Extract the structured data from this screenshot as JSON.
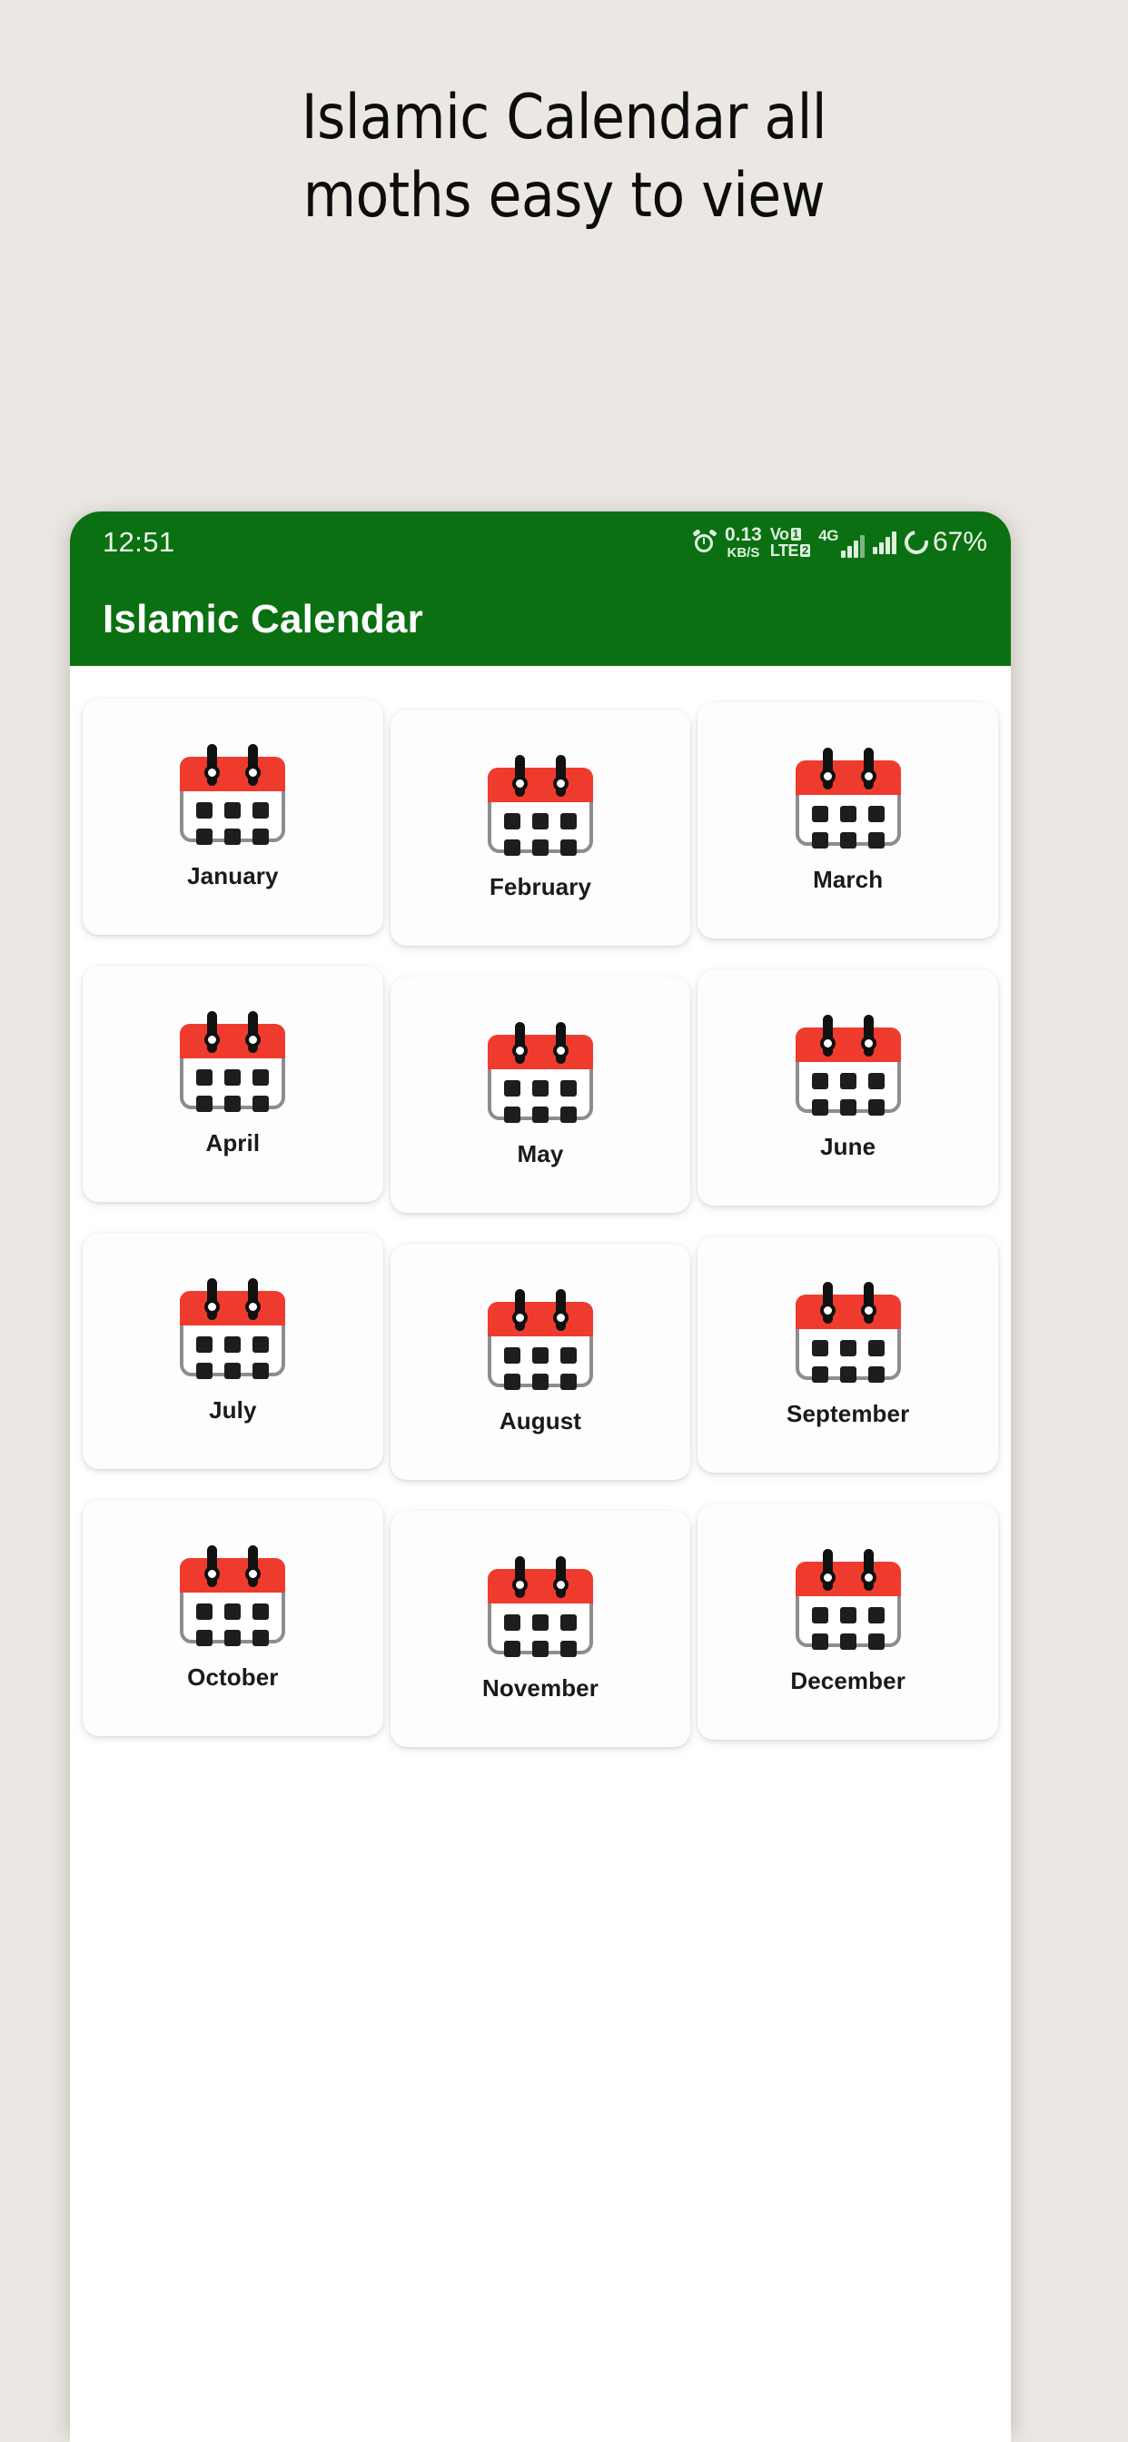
{
  "promo": {
    "headline_line1": "Islamic Calendar all",
    "headline_line2": "moths easy to view",
    "background_color": "#EBE8E4"
  },
  "status_bar": {
    "time": "12:51",
    "net_speed_value": "0.13",
    "net_speed_unit": "KB/S",
    "volte_label": "VoLTE",
    "volte_sim_badge_top": "1",
    "volte_sim_badge_bottom": "2",
    "network_type": "4G",
    "battery_percent": "67%",
    "background_color": "#0b7012",
    "icons": [
      "alarm-clock-icon",
      "network-speed-icon",
      "volte-icon",
      "signal-bars-sim1-icon",
      "signal-bars-sim2-icon",
      "battery-icon"
    ]
  },
  "app_bar": {
    "title": "Islamic Calendar",
    "background_color": "#0b7012",
    "title_color": "#ffffff"
  },
  "months_grid": {
    "columns": 3,
    "card_background": "#fdfdfd",
    "icon_accent_color": "#ef3b2e",
    "icon_dot_color": "#1d1d1d",
    "items": [
      {
        "label": "January",
        "icon": "calendar-icon"
      },
      {
        "label": "February",
        "icon": "calendar-icon"
      },
      {
        "label": "March",
        "icon": "calendar-icon"
      },
      {
        "label": "April",
        "icon": "calendar-icon"
      },
      {
        "label": "May",
        "icon": "calendar-icon"
      },
      {
        "label": "June",
        "icon": "calendar-icon"
      },
      {
        "label": "July",
        "icon": "calendar-icon"
      },
      {
        "label": "August",
        "icon": "calendar-icon"
      },
      {
        "label": "September",
        "icon": "calendar-icon"
      },
      {
        "label": "October",
        "icon": "calendar-icon"
      },
      {
        "label": "November",
        "icon": "calendar-icon"
      },
      {
        "label": "December",
        "icon": "calendar-icon"
      }
    ]
  }
}
